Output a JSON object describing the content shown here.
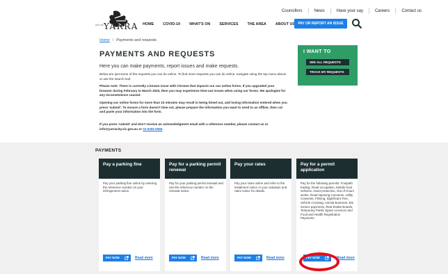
{
  "header": {
    "logo_word": "YARRA",
    "logo_small": "CITY OF",
    "utility": [
      "Councillors",
      "News",
      "Have your say",
      "Careers",
      "Contact us"
    ],
    "nav": [
      "HOME",
      "COVID-19",
      "WHAT'S ON",
      "SERVICES",
      "THE AREA",
      "ABOUT US"
    ],
    "cta_label": "PAY OR REPORT AN ISSUE"
  },
  "breadcrumb": {
    "home": "Home",
    "separator": "/",
    "current": "Payments and requests"
  },
  "page": {
    "title": "PAYMENTS AND REQUESTS",
    "lead": "Here you can make payments, report issues and make requests.",
    "para1": "Below are just some of the requests you can do online. To find more requests you can do online, navigate using the top menu above or use the search tool.",
    "para2": "Please note: There is currently a known issue with Chrome that impacts our our online forms. If you upgraded your browser during February to March 2020, then you may experience time-out issues when using our forms. We apologise for any inconvenience caused.",
    "para3": "Opening our online forms for more than 15 minutes may result in being timed out, and losing information entered when you press 'submit'. To ensure a form doesn't time out, please prepare the information you want to send to us offline, then cut and paste your information into the form.",
    "para4_text": "If you press 'submit' and don't receive an acknowledgment email with a reference number, please contact us at info@yarracity.vic.gov.au or",
    "para4_phone": "03 9205 5555",
    "para4_end": "."
  },
  "iwant": {
    "title": "I WANT TO",
    "buttons": [
      "SEE ALL REQUESTS",
      "TRACK MY REQUESTS"
    ]
  },
  "payments": {
    "heading": "PAYMENTS",
    "pay_label": "PAY NOW",
    "read_label": "Read more",
    "cards": [
      {
        "title": "Pay a parking fine",
        "body": "Pay your parking fine online by entering the reference number on your infringement notice."
      },
      {
        "title": "Pay for a parking permit renewal",
        "body": "Pay for your parking permit renewal and use the reference number on the renewal notice."
      },
      {
        "title": "Pay your rates",
        "body": "Pay your rates online and refer to the instalment notice or your valuation and rates notice for details."
      },
      {
        "title": "Pay for a permit application",
        "body": "Pay for the following permits: Footpath trading, Road occupation, Mobile food vehicles, Asset protection, Out of Hours works, Road Opening Consents, Utility Consents, Filming, Significant Tree, Vehicle Crossing, Animal Business, Bin invoice payments, Real Estate Boards, Temporary Public Space Licences and Food and Health Registration Payments."
      }
    ]
  },
  "colors": {
    "accent_blue": "#1e7fe6",
    "green": "#2e9e66",
    "dark": "#1c2e30",
    "highlight_red": "#e20d1c"
  }
}
